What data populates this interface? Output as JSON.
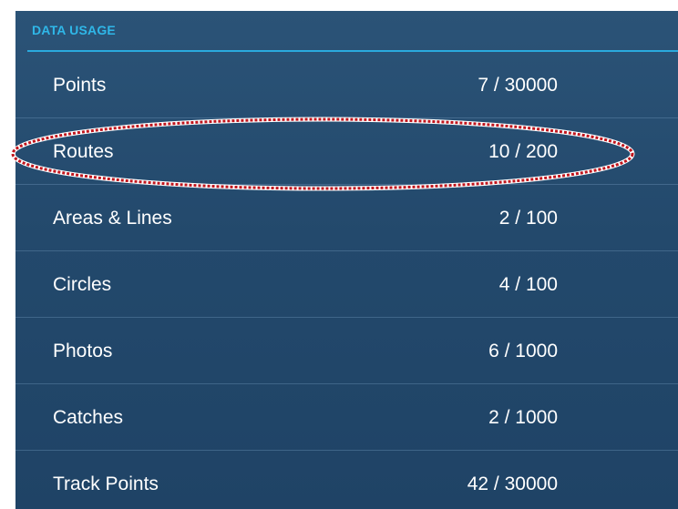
{
  "section": {
    "title": "DATA USAGE"
  },
  "rows": [
    {
      "label": "Points",
      "value": "7 / 30000"
    },
    {
      "label": "Routes",
      "value": "10 / 200"
    },
    {
      "label": "Areas & Lines",
      "value": "2 / 100"
    },
    {
      "label": "Circles",
      "value": "4 / 100"
    },
    {
      "label": "Photos",
      "value": "6 / 1000"
    },
    {
      "label": "Catches",
      "value": "2 / 1000"
    },
    {
      "label": "Track Points",
      "value": "42 / 30000"
    }
  ],
  "colors": {
    "header_text": "#2fb7e8",
    "panel_bg": "#23496c",
    "highlight": "#c0141c"
  }
}
